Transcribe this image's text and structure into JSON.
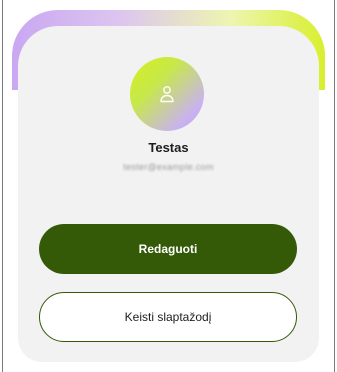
{
  "profile": {
    "name": "Testas",
    "email": "tester@example.com"
  },
  "actions": {
    "edit_label": "Redaguoti",
    "change_password_label": "Keisti slaptažodį"
  },
  "colors": {
    "primary": "#345a08",
    "card_background": "#f2f2f2",
    "gradient_start": "#c9a7f2",
    "gradient_end": "#d8ef2e"
  },
  "icons": {
    "avatar": "user-icon"
  }
}
